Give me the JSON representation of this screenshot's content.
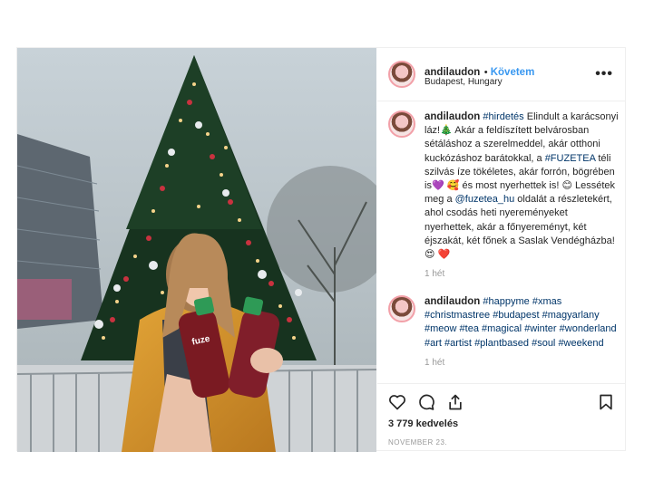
{
  "post": {
    "username": "andilaudon",
    "follow_label": "Követem",
    "location": "Budapest, Hungary",
    "more_label": "•••",
    "caption": {
      "username": "andilaudon",
      "segments": [
        {
          "text": "#hirdetés",
          "tag": true
        },
        {
          "text": " Elindult a karácsonyi láz!🎄 Akár a feldíszített belvárosban sétáláshoz a szerelmeddel, akár otthoni kuckózáshoz barátokkal, a ",
          "tag": false
        },
        {
          "text": "#FUZETEA",
          "tag": true
        },
        {
          "text": " téli szilvás íze tökéletes, akár forrón, bögrében is💜 🥰 és most nyerhettek is! 😊 Lessétek meg a ",
          "tag": false
        },
        {
          "text": "@fuzetea_hu",
          "tag": true
        },
        {
          "text": " oldalát a részletekért, ahol csodás heti nyereményeket nyerhettek, akár a főnyereményt, két éjszakát, két főnek a Saslak Vendégházba!😍 ❤️",
          "tag": false
        }
      ],
      "time": "1 hét"
    },
    "comment2": {
      "username": "andilaudon",
      "segments": [
        {
          "text": "#happyme",
          "tag": true
        },
        {
          "text": " ",
          "tag": false
        },
        {
          "text": "#xmas",
          "tag": true
        },
        {
          "text": " ",
          "tag": false
        },
        {
          "text": "#christmastree",
          "tag": true
        },
        {
          "text": " ",
          "tag": false
        },
        {
          "text": "#budapest",
          "tag": true
        },
        {
          "text": " ",
          "tag": false
        },
        {
          "text": "#magyarlany",
          "tag": true
        },
        {
          "text": " ",
          "tag": false
        },
        {
          "text": "#meow",
          "tag": true
        },
        {
          "text": " ",
          "tag": false
        },
        {
          "text": "#tea",
          "tag": true
        },
        {
          "text": " ",
          "tag": false
        },
        {
          "text": "#magical",
          "tag": true
        },
        {
          "text": " ",
          "tag": false
        },
        {
          "text": "#winter",
          "tag": true
        },
        {
          "text": " ",
          "tag": false
        },
        {
          "text": "#wonderland",
          "tag": true
        },
        {
          "text": " ",
          "tag": false
        },
        {
          "text": "#art",
          "tag": true
        },
        {
          "text": " ",
          "tag": false
        },
        {
          "text": "#artist",
          "tag": true
        },
        {
          "text": " ",
          "tag": false
        },
        {
          "text": "#plantbased",
          "tag": true
        },
        {
          "text": " ",
          "tag": false
        },
        {
          "text": "#soul",
          "tag": true
        },
        {
          "text": " ",
          "tag": false
        },
        {
          "text": "#weekend",
          "tag": true
        }
      ],
      "time": "1 hét"
    },
    "likes": "3 779 kedvelés",
    "date": "NOVEMBER 23.",
    "bottle_label": "fuze",
    "icons": {
      "like": "heart-icon",
      "comment": "comment-icon",
      "share": "share-icon",
      "save": "bookmark-icon"
    },
    "colors": {
      "link": "#3897f0",
      "tag": "#003569",
      "muted": "#999999"
    }
  }
}
